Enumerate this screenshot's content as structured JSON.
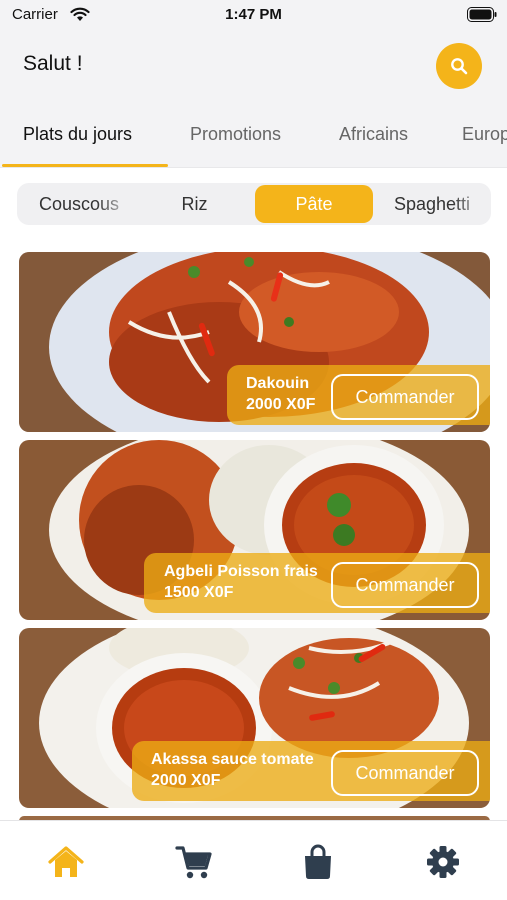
{
  "status_bar": {
    "carrier": "Carrier",
    "time": "1:47 PM"
  },
  "header": {
    "greeting": "Salut  !",
    "search_icon": "search-icon"
  },
  "category_tabs": [
    {
      "label": "Plats du jours",
      "active": true
    },
    {
      "label": "Promotions",
      "active": false
    },
    {
      "label": "Africains",
      "active": false
    },
    {
      "label": "Europ",
      "active": false
    }
  ],
  "sub_tabs": [
    {
      "label": "Couscous",
      "active": false
    },
    {
      "label": "Riz",
      "active": false
    },
    {
      "label": "Pâte",
      "active": true
    },
    {
      "label": "Spaghetti",
      "active": false
    }
  ],
  "dishes": [
    {
      "name": "Dakouin",
      "price": "2000 X0F",
      "action": "Commander"
    },
    {
      "name": "Agbeli Poisson frais",
      "price": "1500 X0F",
      "action": "Commander"
    },
    {
      "name": "Akassa sauce tomate",
      "price": "2000 X0F",
      "action": "Commander"
    }
  ],
  "bottom_nav": [
    {
      "icon": "home-icon",
      "active": true
    },
    {
      "icon": "cart-icon",
      "active": false
    },
    {
      "icon": "bag-icon",
      "active": false
    },
    {
      "icon": "gear-icon",
      "active": false
    }
  ],
  "colors": {
    "accent": "#f4b41a",
    "inactive_icon": "#2f3e4e",
    "background": "#f3f3f5"
  }
}
